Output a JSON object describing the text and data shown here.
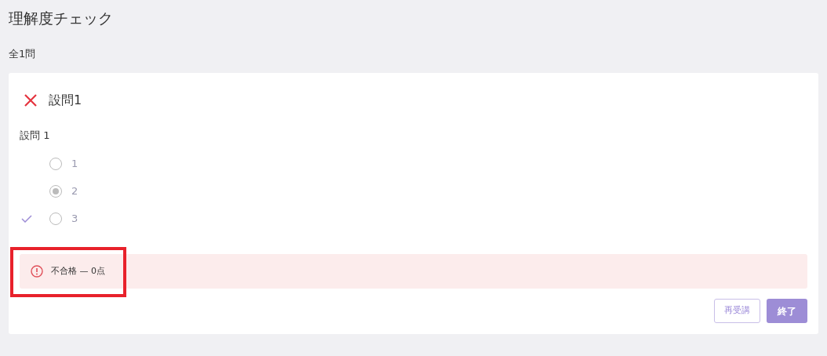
{
  "page": {
    "title": "理解度チェック",
    "count": "全1問"
  },
  "questions": [
    {
      "title": "設問1",
      "correct": false,
      "prompt": "設問 1",
      "options": [
        {
          "label": "1",
          "selected": false,
          "correct": false
        },
        {
          "label": "2",
          "selected": true,
          "correct": false
        },
        {
          "label": "3",
          "selected": false,
          "correct": true
        }
      ]
    }
  ],
  "result": {
    "kind": "fail",
    "text": "不合格 — 0点",
    "highlighted": true
  },
  "buttons": [
    {
      "label": "再受講",
      "kind": "outline"
    },
    {
      "label": "終了",
      "kind": "primary"
    }
  ]
}
